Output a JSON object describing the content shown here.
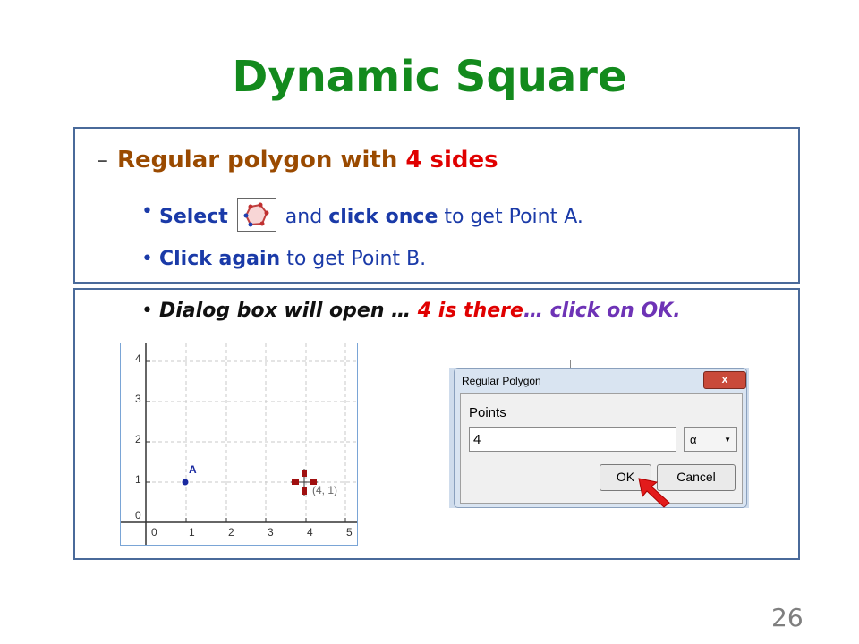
{
  "slide": {
    "title": "Dynamic Square",
    "page_number": "26"
  },
  "heading": {
    "dash": "–",
    "part1": "Regular polygon with ",
    "part2": "4 sides"
  },
  "bullets": {
    "b1": {
      "select": "Select",
      "and": "and ",
      "click_once": "click once",
      "rest": " to get Point A."
    },
    "b2": {
      "click_again": "Click again",
      "rest": " to get Point B."
    },
    "b3": {
      "part1": "Dialog box will open … ",
      "part2": "4 is there",
      "part3": "… ",
      "part4": "click on OK."
    }
  },
  "graph": {
    "x_ticks": [
      "0",
      "1",
      "2",
      "3",
      "4",
      "5"
    ],
    "y_ticks": [
      "0",
      "1",
      "2",
      "3",
      "4"
    ],
    "point_a_label": "A",
    "cursor_label": "(4, 1)"
  },
  "dialog": {
    "title": "Regular Polygon",
    "close_label": "x",
    "field_label": "Points",
    "input_value": "4",
    "alpha_label": "α",
    "ok_label": "OK",
    "cancel_label": "Cancel"
  },
  "colors": {
    "title_green": "#138a1d",
    "heading_brown": "#9a4a00",
    "emphasis_red": "#e00000",
    "text_blue": "#1a3aa8",
    "ok_purple": "#6e33b6"
  }
}
